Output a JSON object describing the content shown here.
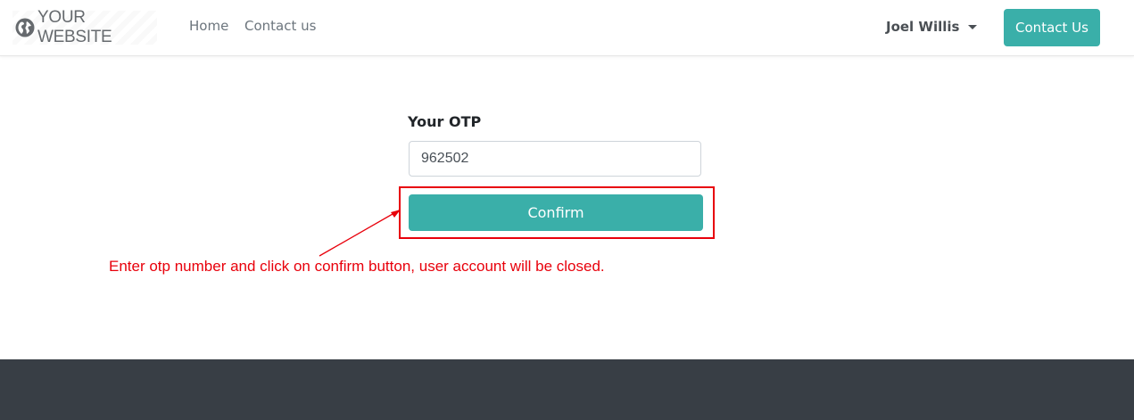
{
  "header": {
    "logo_text": "YOUR WEBSITE",
    "logo_icon": "globe-icon",
    "nav": [
      {
        "label": "Home"
      },
      {
        "label": "Contact us"
      }
    ],
    "user_name": "Joel Willis",
    "user_menu_icon": "caret-down-icon",
    "contact_button_label": "Contact Us"
  },
  "form": {
    "otp_label": "Your OTP",
    "otp_value": "962502",
    "confirm_label": "Confirm"
  },
  "annotation": {
    "text": "Enter otp number and click on confirm button, user account will be closed."
  },
  "colors": {
    "accent": "#3aafa9",
    "annotation_red": "#e8000b",
    "footer": "#383e45"
  }
}
